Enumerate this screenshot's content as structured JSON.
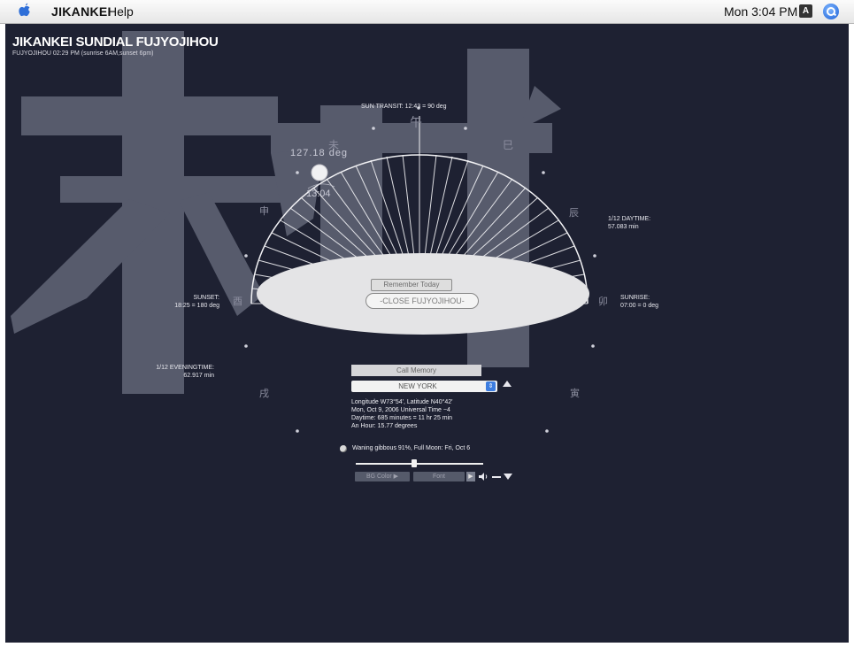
{
  "menubar": {
    "app_name": "JIKANKEI",
    "help": "Help",
    "clock": "Mon 3:04 PM",
    "input_icon": "A"
  },
  "header": {
    "title": "JIKANKEI SUNDIAL FUJYOJIHOU",
    "subtitle": "FUJYOJIHOU 02:29 PM (sunrise 6AM,sunset 6pm)"
  },
  "dial": {
    "sun_transit": "SUN TRANSIT: 12:43 = 90 deg",
    "current_angle": "127.18 deg",
    "current_time": "13:04",
    "daytime_label": "1/12 DAYTIME:",
    "daytime_value": "57.083 min",
    "sunrise_label": "SUNRISE:",
    "sunrise_value": "07:00 = 0 deg",
    "sunset_label": "SUNSET:",
    "sunset_value": "18:25 = 180 deg",
    "eveningtime_label": "1/12 EVENINGTIME:",
    "eveningtime_value": "62.917 min",
    "zodiac_marks": [
      "午",
      "巳",
      "辰",
      "卯",
      "寅",
      "未",
      "申",
      "酉",
      "戌"
    ]
  },
  "buttons": {
    "remember": "Remember Today",
    "close": "-CLOSE FUJYOJIHOU-",
    "call_memory": "Call Memory",
    "bg_color": "BG Color ▶",
    "font": "Font",
    "font_stepper": "▶"
  },
  "location": {
    "city": "NEW YORK",
    "info_lines": [
      "Longitude  W73°54', Latitude N40°42'",
      "Mon, Oct 9, 2006 Universal Time −4",
      "Daytime: 685 minutes = 11 hr 25 min",
      "An Hour: 15.77 degrees"
    ],
    "moon": "Waning gibbous 91%, Full Moon: Fri, Oct 6",
    "slider_value": 0.46
  },
  "colors": {
    "background": "#1e2132",
    "kanji": "#5b5f70",
    "dial_lines": "#f2f2f5",
    "ellipse": "#e4e4e6"
  },
  "icons": {
    "apple": "apple-icon",
    "input_source": "input-source-icon",
    "spotlight": "spotlight-icon",
    "moon": "moon-icon",
    "speaker": "speaker-icon"
  }
}
